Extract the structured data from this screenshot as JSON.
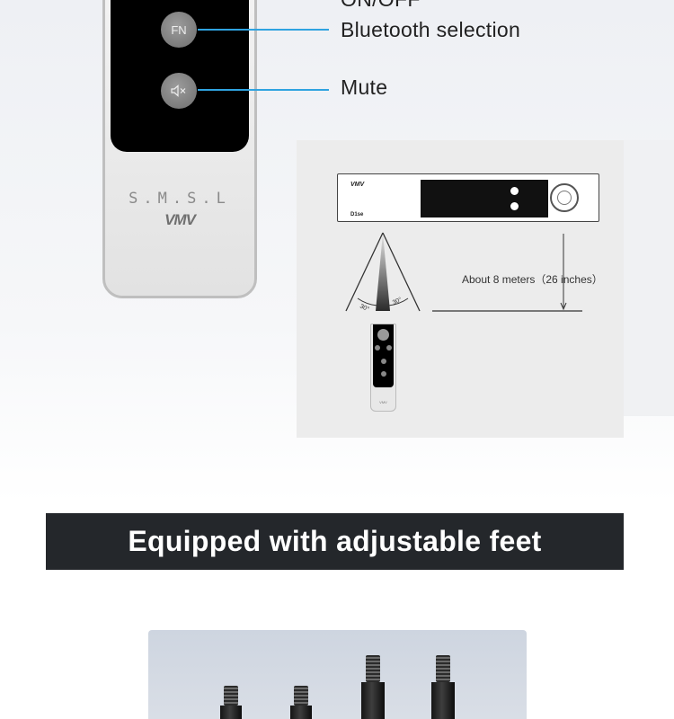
{
  "remote": {
    "buttons": [
      {
        "name": "fn",
        "label": "FN"
      },
      {
        "name": "mute",
        "label": "🔇"
      }
    ],
    "brand_text": "S.M.S.L",
    "logo_text": "VMV"
  },
  "callouts": {
    "top_partial": "ON/OFF",
    "bluetooth": "Bluetooth selection",
    "mute": "Mute"
  },
  "diagram": {
    "device_logo": "VMV",
    "device_model": "D1se",
    "angle_left": "30°",
    "angle_right": "30°",
    "distance_label": "About 8 meters（26 inches）",
    "mini_remote_brand": "VMV"
  },
  "banner": {
    "title": "Equipped with adjustable feet"
  },
  "colors": {
    "callout_line": "#2fa3e0",
    "banner_bg": "#24272b",
    "photo_bg": "#d3d9e2"
  }
}
